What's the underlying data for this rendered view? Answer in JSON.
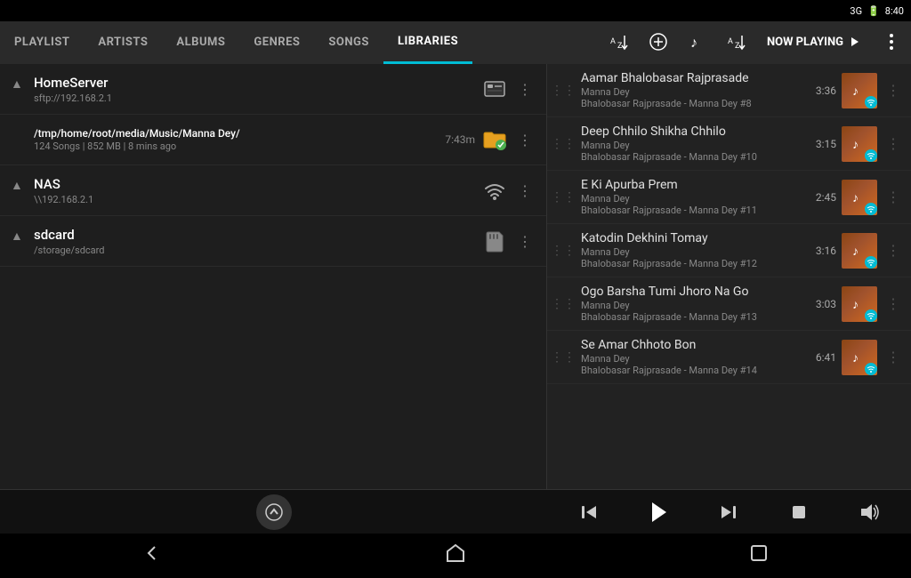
{
  "statusBar": {
    "network": "3G",
    "battery": "🔋",
    "time": "8:40"
  },
  "tabs": [
    {
      "id": "playlist",
      "label": "Playlist",
      "active": false
    },
    {
      "id": "artists",
      "label": "Artists",
      "active": false
    },
    {
      "id": "albums",
      "label": "Albums",
      "active": false
    },
    {
      "id": "genres",
      "label": "Genres",
      "active": false
    },
    {
      "id": "songs",
      "label": "Songs",
      "active": false
    },
    {
      "id": "libraries",
      "label": "Libraries",
      "active": true
    }
  ],
  "toolbar": {
    "sortAZ1": "A-Z↓",
    "addIcon": "+",
    "musicNote": "♪",
    "sortAZ2": "A-Z↓",
    "nowPlaying": "Now playing"
  },
  "libraries": [
    {
      "name": "HomeServer",
      "path": "sftp://192.168.2.1",
      "meta": "",
      "time": "",
      "iconType": "sftp",
      "collapsed": true
    },
    {
      "name": "/tmp/home/root/media/Music/Manna Dey/",
      "path": "",
      "meta": "124 Songs | 852 MB | 8 mins ago",
      "time": "7:43m",
      "iconType": "folder-ok",
      "collapsed": false
    },
    {
      "name": "NAS",
      "path": "\\\\192.168.2.1",
      "meta": "",
      "time": "",
      "iconType": "wifi",
      "collapsed": true
    },
    {
      "name": "sdcard",
      "path": "/storage/sdcard",
      "meta": "",
      "time": "",
      "iconType": "sdcard",
      "collapsed": true
    }
  ],
  "songs": [
    {
      "title": "Aamar Bhalobasar Rajprasade",
      "artist": "Manna Dey",
      "album": "Bhalobasar Rajprasade - Manna Dey #8",
      "duration": "3:36"
    },
    {
      "title": "Deep Chhilo Shikha Chhilo",
      "artist": "Manna Dey",
      "album": "Bhalobasar Rajprasade - Manna Dey #10",
      "duration": "3:15"
    },
    {
      "title": "E Ki Apurba Prem",
      "artist": "Manna Dey",
      "album": "Bhalobasar Rajprasade - Manna Dey #11",
      "duration": "2:45"
    },
    {
      "title": "Katodin Dekhini Tomay",
      "artist": "Manna Dey",
      "album": "Bhalobasar Rajprasade - Manna Dey #12",
      "duration": "3:16"
    },
    {
      "title": "Ogo Barsha Tumi Jhoro Na Go",
      "artist": "Manna Dey",
      "album": "Bhalobasar Rajprasade - Manna Dey #13",
      "duration": "3:03"
    },
    {
      "title": "Se Amar Chhoto Bon",
      "artist": "Manna Dey",
      "album": "Bhalobasar Rajprasade - Manna Dey #14",
      "duration": "6:41"
    }
  ],
  "player": {
    "upBtn": "▲",
    "prevBtn": "⏮",
    "playBtn": "▶",
    "nextBtn": "⏭",
    "stopBtn": "■",
    "volumeBtn": "🔊"
  },
  "nav": {
    "backBtn": "◁",
    "homeBtn": "△",
    "recentBtn": "□"
  }
}
